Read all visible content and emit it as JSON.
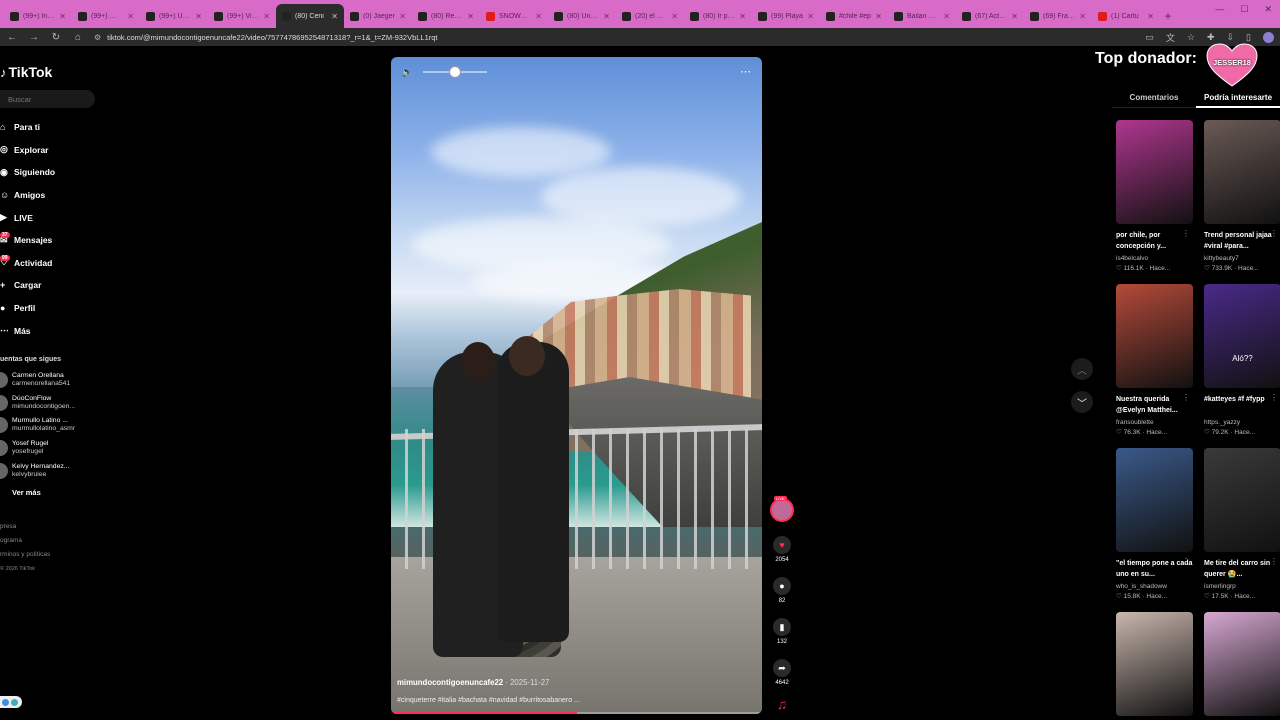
{
  "browser": {
    "tabs": [
      {
        "title": "(99+) Inicio",
        "icon": "tiktok"
      },
      {
        "title": "(99+) 🥰🥰",
        "icon": "tiktok"
      },
      {
        "title": "(99+) Unbox",
        "icon": "tiktok"
      },
      {
        "title": "(99+) Video",
        "icon": "tiktok"
      },
      {
        "title": "(80) Ceni",
        "icon": "tiktok",
        "active": true
      },
      {
        "title": "(0) Jaeger",
        "icon": "tiktok"
      },
      {
        "title": "(80) Reaction",
        "icon": "tiktok"
      },
      {
        "title": "SNOWMAN",
        "icon": "youtube"
      },
      {
        "title": "(80) Unbox",
        "icon": "tiktok"
      },
      {
        "title": "(20) el grupo",
        "icon": "tiktok"
      },
      {
        "title": "(80) Ir por el",
        "icon": "tiktok"
      },
      {
        "title": "(99) Playa",
        "icon": "tiktok"
      },
      {
        "title": "#chile #ep",
        "icon": "tiktok"
      },
      {
        "title": "Bailan Mon",
        "icon": "tiktok"
      },
      {
        "title": "(67) Actual",
        "icon": "tiktok"
      },
      {
        "title": "(69) Fraser",
        "icon": "tiktok"
      },
      {
        "title": "(1) Cartu",
        "icon": "youtube"
      }
    ],
    "url": "tiktok.com/@mimundocontigoenuncafe22/video/7577478695254871318?_r=1&_t=ZM-932VbLL1rqt"
  },
  "sidebar": {
    "logo": "TikTok",
    "search_placeholder": "Buscar",
    "nav": [
      {
        "label": "Para ti",
        "icon": "home-icon"
      },
      {
        "label": "Explorar",
        "icon": "compass-icon"
      },
      {
        "label": "Siguiendo",
        "icon": "following-icon"
      },
      {
        "label": "Amigos",
        "icon": "friends-icon"
      },
      {
        "label": "LIVE",
        "icon": "live-icon"
      },
      {
        "label": "Mensajes",
        "icon": "messages-icon",
        "badge": "37"
      },
      {
        "label": "Actividad",
        "icon": "activity-icon",
        "badge": "99"
      },
      {
        "label": "Cargar",
        "icon": "upload-icon"
      },
      {
        "label": "Perfil",
        "icon": "profile-icon"
      },
      {
        "label": "Más",
        "icon": "more-icon"
      }
    ],
    "following_title": "uentas que sigues",
    "following": [
      {
        "name": "Carmen Orellana",
        "user": "carmenorellana541"
      },
      {
        "name": "DúoConFlow",
        "user": "mimundocontigoen..."
      },
      {
        "name": "Murmullo Latino ...",
        "user": "murmullolatino_asmr"
      },
      {
        "name": "Yosef Rugel",
        "user": "yosefrugel"
      },
      {
        "name": "Kelvy Hernandez...",
        "user": "kelvybrulee"
      }
    ],
    "see_more": "Ver más",
    "footer": [
      "presa",
      "ograma",
      "rminos y políticas"
    ],
    "copyright": "2026 TikTok"
  },
  "video": {
    "author": "mimundocontigoenuncafe22",
    "date": "· 2025-11-27",
    "caption": "#cinqueterre #italia #bachata #navidad #burritosabanero ...",
    "volume_level": 0.5,
    "progress": 0.5
  },
  "actions": {
    "live_badge": "LIVE",
    "likes": "2054",
    "comments": "82",
    "saves": "132",
    "shares": "4642"
  },
  "right_panel": {
    "top_donor_label": "Top donador:",
    "top_donor_name": "JESSER18",
    "tabs": [
      "Comentarios",
      "Podría interesarte"
    ],
    "active_tab": 1,
    "videos": [
      {
        "caption": "por chile, por concepción y...",
        "user": "is4belcalvo",
        "stats": "♡ 116.1K · Hace...",
        "color": "#b0368f"
      },
      {
        "caption": "Trend personal jajaa #viral #para...",
        "user": "kittybeauty7",
        "stats": "♡ 733.9K · Hace...",
        "color": "#6a5a55"
      },
      {
        "caption": "Nuestra querida @Evelyn Matthei...",
        "user": "fransoublette",
        "stats": "♡ 76.3K · Hace...",
        "color": "#b54a3a"
      },
      {
        "caption": "#katteyes #f #fypp",
        "user": "https._yazzy",
        "stats": "♡ 79.2K · Hace...",
        "color": "#4a2a8a",
        "overlay": "Aló??"
      },
      {
        "caption": "\"el tiempo pone a cada uno en su...",
        "user": "who_is_shadoww",
        "stats": "♡ 15.8K · Hace...",
        "color": "#3a5a8a"
      },
      {
        "caption": "Me tire del carro sin querer 😭...",
        "user": "ismerlingrp",
        "stats": "♡ 17.5K · Hace...",
        "color": "#3a3a3a"
      },
      {
        "caption": "",
        "user": "",
        "stats": "",
        "color": "#c9b7ad"
      },
      {
        "caption": "",
        "user": "",
        "stats": "",
        "color": "#d7a8d2"
      }
    ]
  },
  "colors": {
    "accent": "#fe2c55",
    "tabbar": "#d86bc8"
  }
}
